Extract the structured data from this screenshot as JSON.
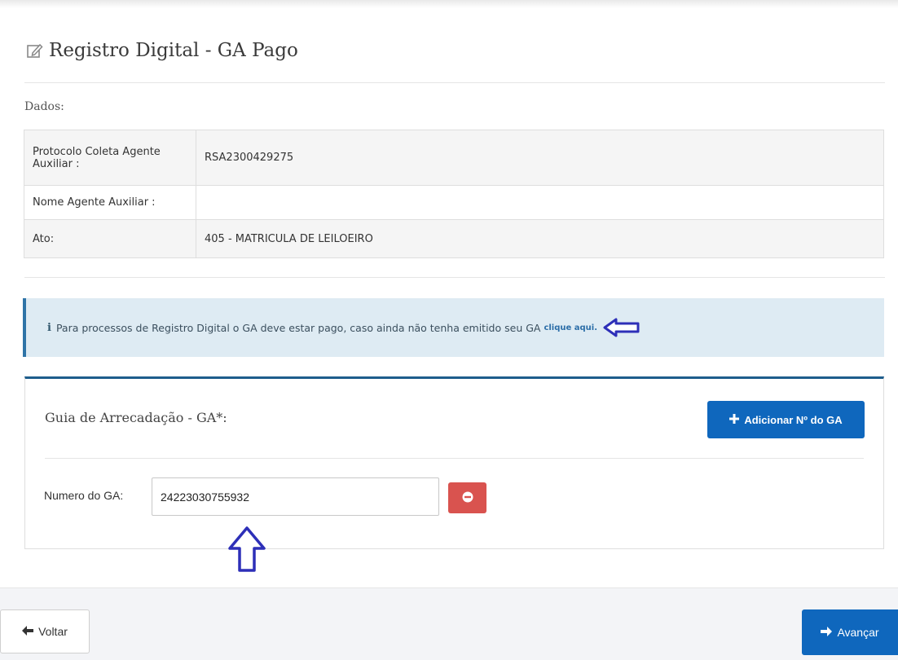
{
  "page": {
    "title": "Registro Digital - GA Pago",
    "title_icon": "edit-icon"
  },
  "dados": {
    "label": "Dados:",
    "rows": [
      {
        "label": "Protocolo Coleta Agente Auxiliar :",
        "value": "RSA2300429275"
      },
      {
        "label": "Nome Agente Auxiliar :",
        "value": ""
      },
      {
        "label": "Ato:",
        "value": "405 - MATRICULA DE LEILOEIRO"
      }
    ]
  },
  "info": {
    "icon": "i",
    "text": "Para processos de Registro Digital o GA deve estar pago, caso ainda não tenha emitido seu GA",
    "link_label": "clique aqui.",
    "accent_color": "#2f74a7",
    "background_color": "#deebf3"
  },
  "ga_panel": {
    "title": "Guia de Arrecadação - GA*:",
    "add_button_label": "Adicionar Nº do GA",
    "add_button_icon": "plus-icon",
    "number_label": "Numero do GA:",
    "number_value": "24223030755932",
    "remove_button_icon": "minus-circle-icon",
    "remove_button_color": "#d9534f",
    "accent_color": "#1e5d8c"
  },
  "annotations": {
    "pointer_icons": [
      "arrow-left-icon",
      "arrow-up-icon"
    ],
    "pointer_color": "#2d2fb8"
  },
  "footer": {
    "back_label": "Voltar",
    "back_icon": "arrow-left-icon",
    "next_label": "Avançar",
    "next_icon": "arrow-right-icon",
    "primary_color": "#0f67bd"
  }
}
